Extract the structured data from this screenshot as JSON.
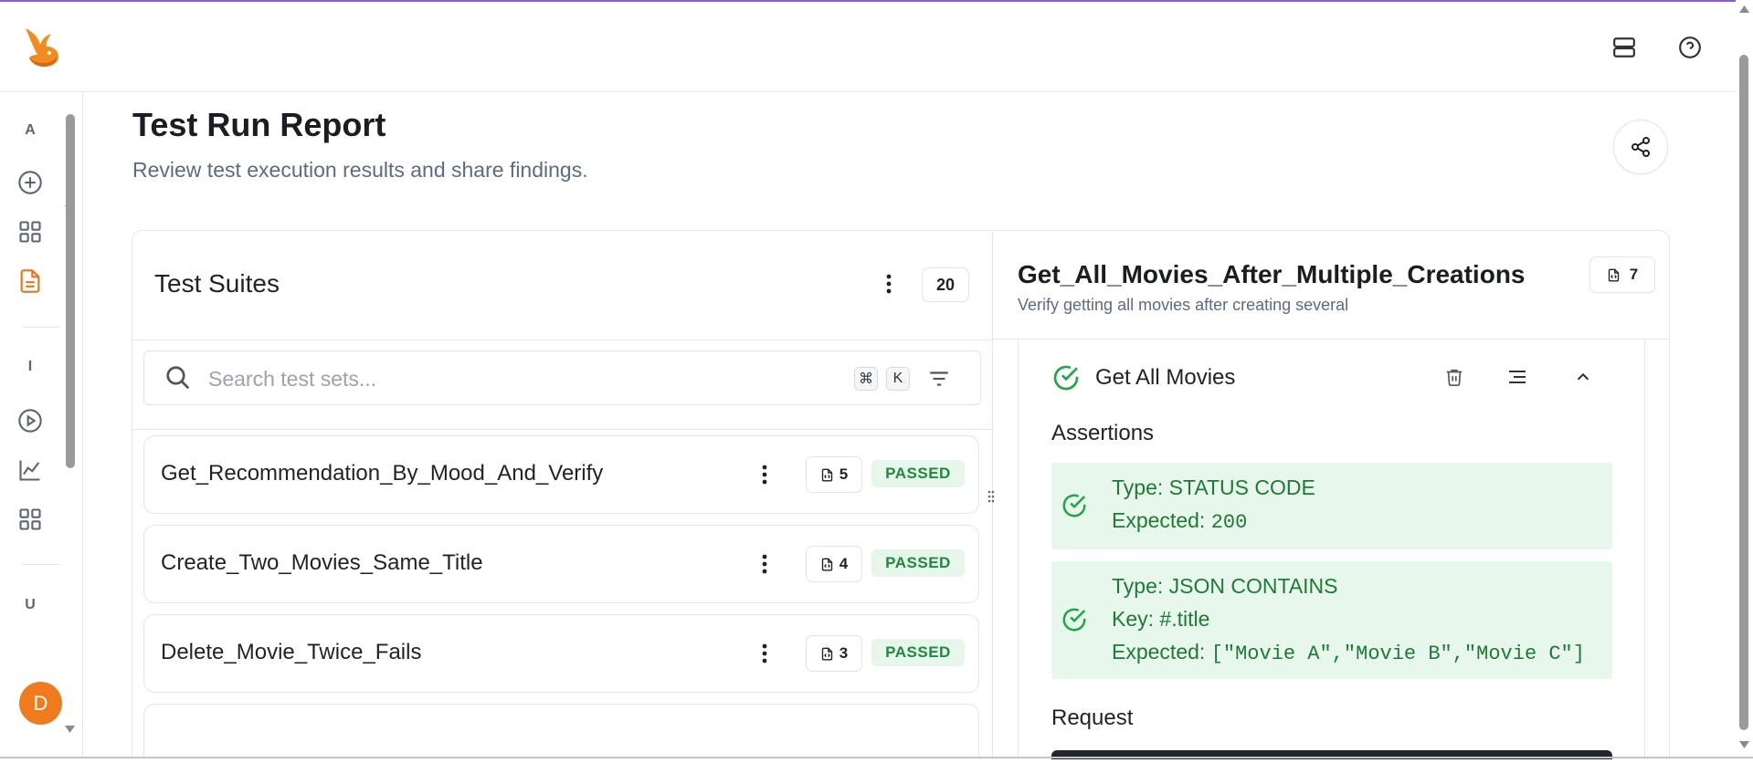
{
  "header": {
    "logo_alt": "rabbit-logo",
    "icons": [
      "server-icon",
      "help-icon"
    ]
  },
  "sidebar": {
    "groups": [
      {
        "label": "A",
        "items": [
          {
            "icon": "plus-circle-icon",
            "name": "new"
          },
          {
            "icon": "grid-icon",
            "name": "dashboard"
          },
          {
            "icon": "document-icon",
            "name": "reports",
            "active": true
          }
        ]
      },
      {
        "label": "I",
        "items": [
          {
            "icon": "play-circle-icon",
            "name": "run"
          },
          {
            "icon": "chart-line-icon",
            "name": "analytics"
          },
          {
            "icon": "grid-icon",
            "name": "integrations"
          }
        ]
      },
      {
        "label": "U",
        "items": []
      }
    ],
    "avatar_initial": "D",
    "accent": "#e8731a"
  },
  "page": {
    "title": "Test Run Report",
    "subtitle": "Review test execution results and share findings."
  },
  "suites": {
    "title": "Test Suites",
    "count": "20",
    "search_placeholder": "Search test sets...",
    "shortcut_keys": [
      "⌘",
      "K"
    ],
    "items": [
      {
        "name": "Get_Recommendation_By_Mood_And_Verify",
        "steps": "5",
        "status": "PASSED"
      },
      {
        "name": "Create_Two_Movies_Same_Title",
        "steps": "4",
        "status": "PASSED"
      },
      {
        "name": "Delete_Movie_Twice_Fails",
        "steps": "3",
        "status": "PASSED"
      }
    ]
  },
  "detail": {
    "title": "Get_All_Movies_After_Multiple_Creations",
    "description": "Verify getting all movies after creating several",
    "steps": "7",
    "step": {
      "name": "Get All Movies",
      "assertions_heading": "Assertions",
      "assertions": [
        {
          "type_line": "Type: STATUS CODE",
          "expected_label": "Expected: ",
          "expected_value": "200"
        },
        {
          "type_line": "Type: JSON CONTAINS",
          "key_line": "Key: #.title",
          "expected_label": "Expected: ",
          "expected_value": "[\"Movie A\",\"Movie B\",\"Movie C\"]"
        }
      ],
      "request_heading": "Request"
    }
  },
  "colors": {
    "pass_bg": "#e6f6ea",
    "pass_text": "#1e8a3c",
    "assert_bg": "#e8f7ec",
    "check_green": "#22a447"
  }
}
